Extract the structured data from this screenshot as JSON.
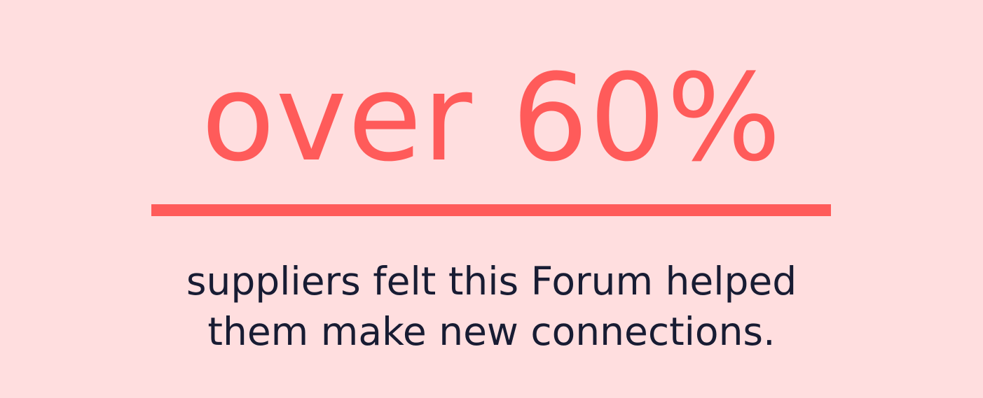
{
  "stat": {
    "headline": "over 60%",
    "caption_lines": [
      "suppliers felt this Forum helped",
      "them make new connections."
    ]
  },
  "colors": {
    "background": "#FFDEDF",
    "accent": "#FF5B5A",
    "text": "#181C33"
  }
}
